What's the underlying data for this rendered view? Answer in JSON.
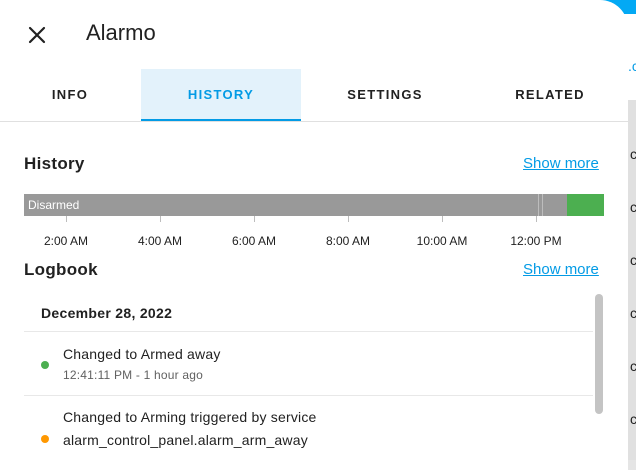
{
  "dialog": {
    "title": "Alarmo"
  },
  "tabs": [
    {
      "label": "INFO",
      "active": false
    },
    {
      "label": "HISTORY",
      "active": true
    },
    {
      "label": "SETTINGS",
      "active": false
    },
    {
      "label": "RELATED",
      "active": false
    }
  ],
  "history": {
    "title": "History",
    "show_more": "Show more",
    "state_label": "Disarmed",
    "time_labels": [
      "2:00 AM",
      "4:00 AM",
      "6:00 AM",
      "8:00 AM",
      "10:00 AM",
      "12:00 PM"
    ]
  },
  "logbook": {
    "title": "Logbook",
    "show_more": "Show more",
    "date": "December 28, 2022",
    "entries": [
      {
        "title": "Changed to Armed away",
        "sub": "12:41:11 PM - 1 hour ago",
        "color": "#4caf50"
      },
      {
        "title": "Changed to Arming triggered by service",
        "sub": "alarm_control_panel.alarm_arm_away",
        "color": "#ff9800"
      }
    ]
  },
  "background_page": {
    "top_char": ".c",
    "row_chars": [
      "c",
      "c",
      "c",
      "c",
      "c",
      "c"
    ]
  },
  "colors": {
    "accent": "#039be5",
    "disarmed": "#999999",
    "armed": "#4caf50",
    "arming": "#ff9800"
  }
}
